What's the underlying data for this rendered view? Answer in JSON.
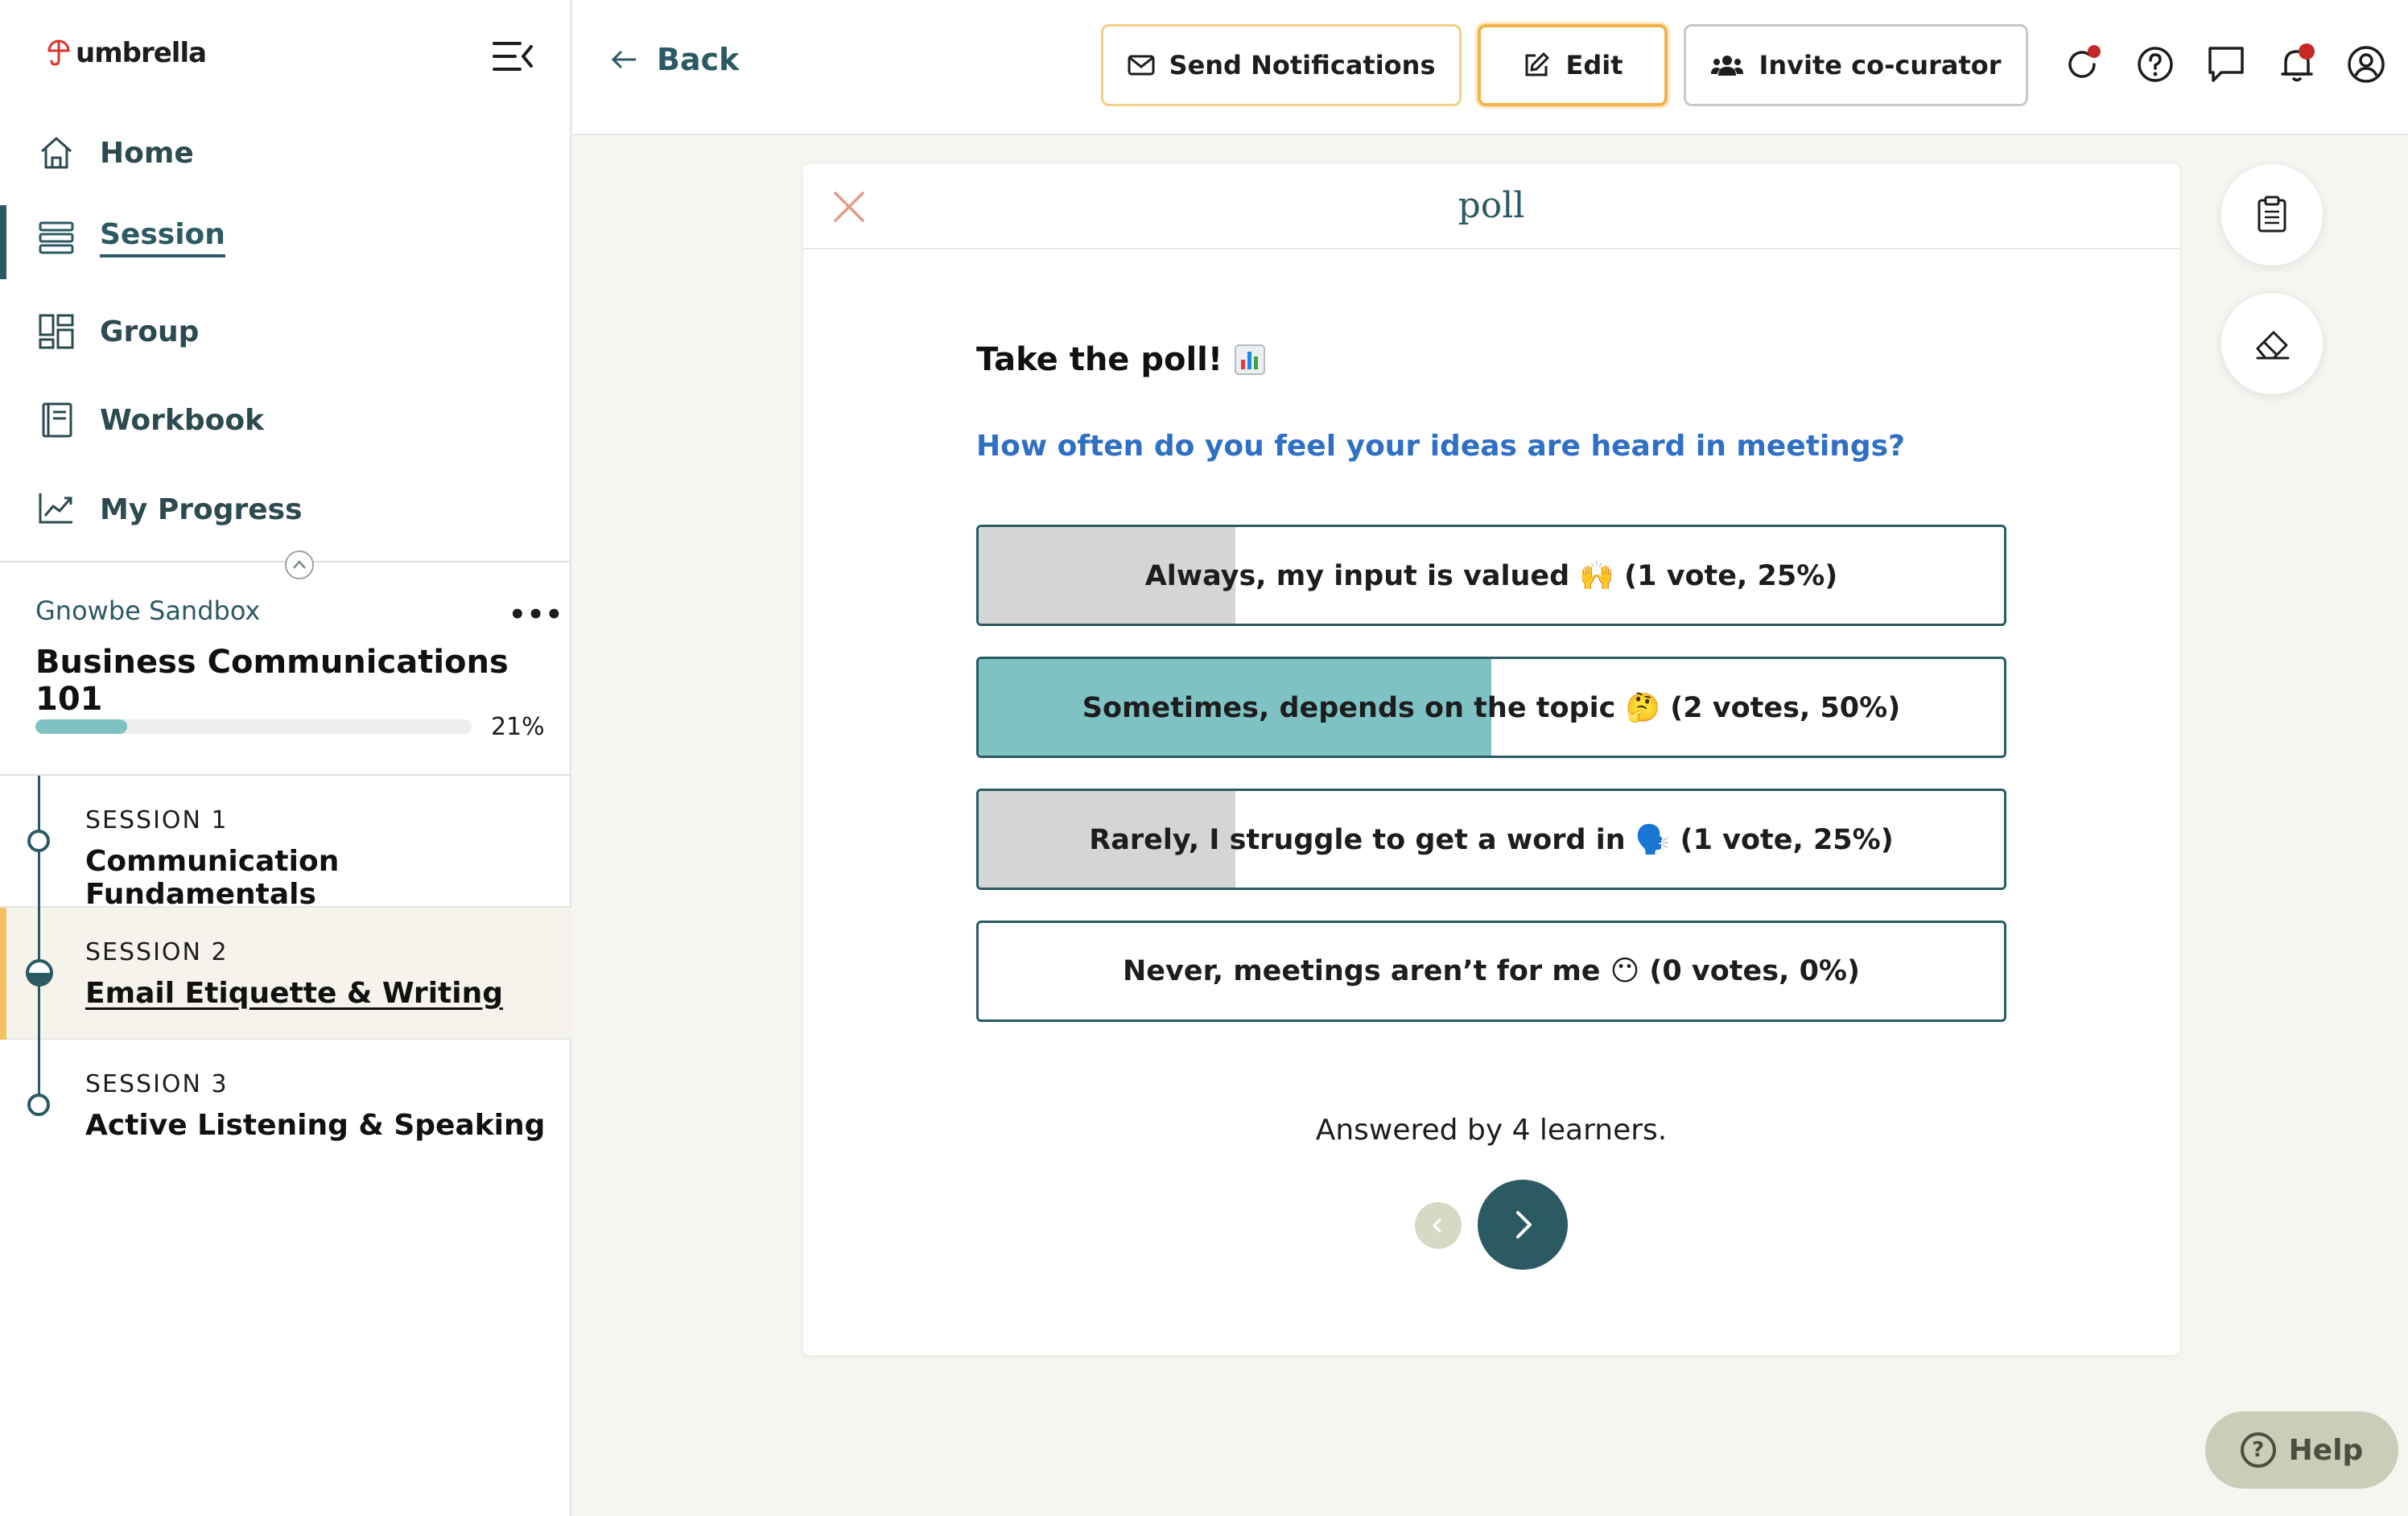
{
  "brand": {
    "name": "umbrella",
    "accent": "#2c5a63",
    "highlight": "#f0b34a",
    "link": "#2f6fc4"
  },
  "sidebar": {
    "nav": [
      {
        "label": "Home",
        "icon": "home-icon"
      },
      {
        "label": "Session",
        "icon": "session-list-icon",
        "active": true
      },
      {
        "label": "Group",
        "icon": "group-icon"
      },
      {
        "label": "Workbook",
        "icon": "workbook-icon"
      },
      {
        "label": "My Progress",
        "icon": "chart-line-icon"
      }
    ],
    "org": "Gnowbe Sandbox",
    "more": "•••",
    "course": "Business Communications 101",
    "progress": {
      "value": 0.21,
      "label": "21%"
    },
    "sessions": [
      {
        "num": "SESSION 1",
        "name": "Communication Fundamentals"
      },
      {
        "num": "SESSION 2",
        "name": "Email Etiquette & Writing",
        "current": true
      },
      {
        "num": "SESSION 3",
        "name": "Active Listening & Speaking"
      }
    ]
  },
  "header": {
    "back": "Back",
    "buttons": {
      "notify": "Send Notifications",
      "edit": "Edit",
      "invite": "Invite co-curator"
    },
    "icons": [
      "refresh-icon",
      "help-icon",
      "chat-icon",
      "bell-icon",
      "user-icon"
    ]
  },
  "poll": {
    "title": "poll",
    "heading": "Take the poll!",
    "question": "How often do you feel your ideas are heard in meetings?",
    "options": [
      {
        "label": "Always, my input is valued 🙌 (1 vote, 25%)",
        "share": 0.25
      },
      {
        "label": "Sometimes, depends on the topic 🤔 (2 votes, 50%)",
        "share": 0.5,
        "leading": true
      },
      {
        "label": "Rarely, I struggle to get a word in 🗣️ (1 vote, 25%)",
        "share": 0.25
      },
      {
        "label": "Never, meetings aren’t for me 😶 (0 votes, 0%)",
        "share": 0
      }
    ],
    "answered": "Answered by 4 learners."
  },
  "help": {
    "label": "Help"
  }
}
